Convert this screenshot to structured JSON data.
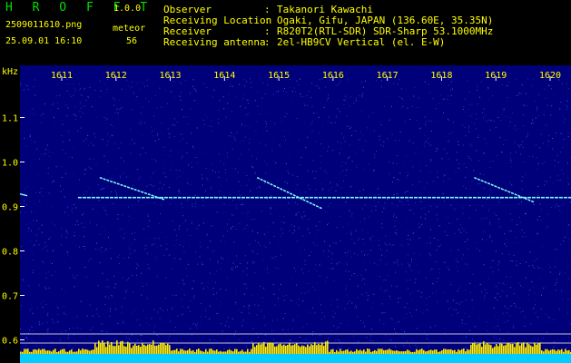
{
  "header": {
    "app_name": "H R O F F T",
    "version": "1.0.0",
    "filename": "2509011610.png",
    "meteor_label": "meteor",
    "timestamp": "25.09.01 16:10",
    "meteor_count": "56",
    "info_labels": [
      "Observer",
      "Receiving Location",
      "Receiver",
      "Receiving antenna"
    ],
    "info_separator": ":",
    "info_values": [
      "Takanori Kawachi",
      "Ogaki, Gifu, JAPAN (136.60E, 35.35N)",
      "R820T2(RTL-SDR) SDR-Sharp 53.1000MHz",
      "2el-HB9CV Vertical (el. E-W)"
    ]
  },
  "axes": {
    "y_unit": "kHz",
    "y_ticks": [
      "1.1",
      "1.0",
      "0.9",
      "0.8",
      "0.7",
      "0.6"
    ],
    "x_ticks": [
      "1611",
      "1612",
      "1613",
      "1614",
      "1615",
      "1616",
      "1617",
      "1618",
      "1619",
      "1620"
    ]
  },
  "colors": {
    "background": "#000000",
    "plot_background": "#00007a",
    "header_text": "#ffff00",
    "app_name": "#00e000",
    "grid": "#ffffff",
    "trace": "#7fffff",
    "level_bars": "#ffee00",
    "level_base": "#00ccff"
  },
  "chart_data": {
    "type": "heatmap",
    "title": "",
    "xlabel": "",
    "ylabel": "kHz",
    "x_range": [
      1611,
      1620
    ],
    "ylim": [
      0.6,
      1.15
    ],
    "carrier_khz": 0.92,
    "meteor_traces": [
      {
        "start_min": 1611.7,
        "end_min": 1612.9,
        "start_khz": 0.965,
        "end_khz": 0.915
      },
      {
        "start_min": 1614.6,
        "end_min": 1615.8,
        "start_khz": 0.965,
        "end_khz": 0.895
      },
      {
        "start_min": 1618.6,
        "end_min": 1619.7,
        "start_khz": 0.965,
        "end_khz": 0.91
      }
    ]
  }
}
